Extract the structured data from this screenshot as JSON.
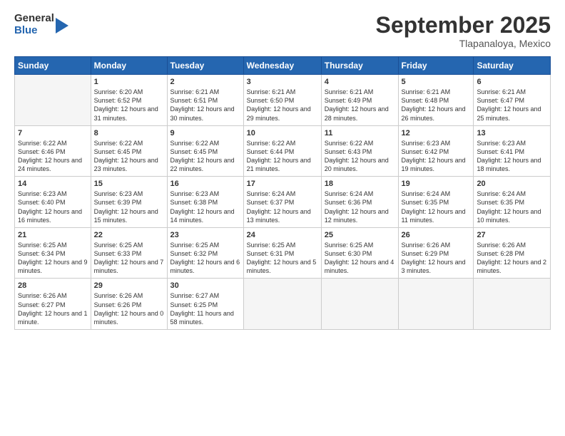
{
  "logo": {
    "general": "General",
    "blue": "Blue"
  },
  "header": {
    "month": "September 2025",
    "location": "Tlapanaloya, Mexico"
  },
  "weekdays": [
    "Sunday",
    "Monday",
    "Tuesday",
    "Wednesday",
    "Thursday",
    "Friday",
    "Saturday"
  ],
  "weeks": [
    [
      {
        "day": "",
        "empty": true
      },
      {
        "day": "1",
        "sunrise": "6:20 AM",
        "sunset": "6:52 PM",
        "daylight": "12 hours and 31 minutes."
      },
      {
        "day": "2",
        "sunrise": "6:21 AM",
        "sunset": "6:51 PM",
        "daylight": "12 hours and 30 minutes."
      },
      {
        "day": "3",
        "sunrise": "6:21 AM",
        "sunset": "6:50 PM",
        "daylight": "12 hours and 29 minutes."
      },
      {
        "day": "4",
        "sunrise": "6:21 AM",
        "sunset": "6:49 PM",
        "daylight": "12 hours and 28 minutes."
      },
      {
        "day": "5",
        "sunrise": "6:21 AM",
        "sunset": "6:48 PM",
        "daylight": "12 hours and 26 minutes."
      },
      {
        "day": "6",
        "sunrise": "6:21 AM",
        "sunset": "6:47 PM",
        "daylight": "12 hours and 25 minutes."
      }
    ],
    [
      {
        "day": "7",
        "sunrise": "6:22 AM",
        "sunset": "6:46 PM",
        "daylight": "12 hours and 24 minutes."
      },
      {
        "day": "8",
        "sunrise": "6:22 AM",
        "sunset": "6:45 PM",
        "daylight": "12 hours and 23 minutes."
      },
      {
        "day": "9",
        "sunrise": "6:22 AM",
        "sunset": "6:45 PM",
        "daylight": "12 hours and 22 minutes."
      },
      {
        "day": "10",
        "sunrise": "6:22 AM",
        "sunset": "6:44 PM",
        "daylight": "12 hours and 21 minutes."
      },
      {
        "day": "11",
        "sunrise": "6:22 AM",
        "sunset": "6:43 PM",
        "daylight": "12 hours and 20 minutes."
      },
      {
        "day": "12",
        "sunrise": "6:23 AM",
        "sunset": "6:42 PM",
        "daylight": "12 hours and 19 minutes."
      },
      {
        "day": "13",
        "sunrise": "6:23 AM",
        "sunset": "6:41 PM",
        "daylight": "12 hours and 18 minutes."
      }
    ],
    [
      {
        "day": "14",
        "sunrise": "6:23 AM",
        "sunset": "6:40 PM",
        "daylight": "12 hours and 16 minutes."
      },
      {
        "day": "15",
        "sunrise": "6:23 AM",
        "sunset": "6:39 PM",
        "daylight": "12 hours and 15 minutes."
      },
      {
        "day": "16",
        "sunrise": "6:23 AM",
        "sunset": "6:38 PM",
        "daylight": "12 hours and 14 minutes."
      },
      {
        "day": "17",
        "sunrise": "6:24 AM",
        "sunset": "6:37 PM",
        "daylight": "12 hours and 13 minutes."
      },
      {
        "day": "18",
        "sunrise": "6:24 AM",
        "sunset": "6:36 PM",
        "daylight": "12 hours and 12 minutes."
      },
      {
        "day": "19",
        "sunrise": "6:24 AM",
        "sunset": "6:35 PM",
        "daylight": "12 hours and 11 minutes."
      },
      {
        "day": "20",
        "sunrise": "6:24 AM",
        "sunset": "6:35 PM",
        "daylight": "12 hours and 10 minutes."
      }
    ],
    [
      {
        "day": "21",
        "sunrise": "6:25 AM",
        "sunset": "6:34 PM",
        "daylight": "12 hours and 9 minutes."
      },
      {
        "day": "22",
        "sunrise": "6:25 AM",
        "sunset": "6:33 PM",
        "daylight": "12 hours and 7 minutes."
      },
      {
        "day": "23",
        "sunrise": "6:25 AM",
        "sunset": "6:32 PM",
        "daylight": "12 hours and 6 minutes."
      },
      {
        "day": "24",
        "sunrise": "6:25 AM",
        "sunset": "6:31 PM",
        "daylight": "12 hours and 5 minutes."
      },
      {
        "day": "25",
        "sunrise": "6:25 AM",
        "sunset": "6:30 PM",
        "daylight": "12 hours and 4 minutes."
      },
      {
        "day": "26",
        "sunrise": "6:26 AM",
        "sunset": "6:29 PM",
        "daylight": "12 hours and 3 minutes."
      },
      {
        "day": "27",
        "sunrise": "6:26 AM",
        "sunset": "6:28 PM",
        "daylight": "12 hours and 2 minutes."
      }
    ],
    [
      {
        "day": "28",
        "sunrise": "6:26 AM",
        "sunset": "6:27 PM",
        "daylight": "12 hours and 1 minute."
      },
      {
        "day": "29",
        "sunrise": "6:26 AM",
        "sunset": "6:26 PM",
        "daylight": "12 hours and 0 minutes."
      },
      {
        "day": "30",
        "sunrise": "6:27 AM",
        "sunset": "6:25 PM",
        "daylight": "11 hours and 58 minutes."
      },
      {
        "day": "",
        "empty": true
      },
      {
        "day": "",
        "empty": true
      },
      {
        "day": "",
        "empty": true
      },
      {
        "day": "",
        "empty": true
      }
    ]
  ]
}
